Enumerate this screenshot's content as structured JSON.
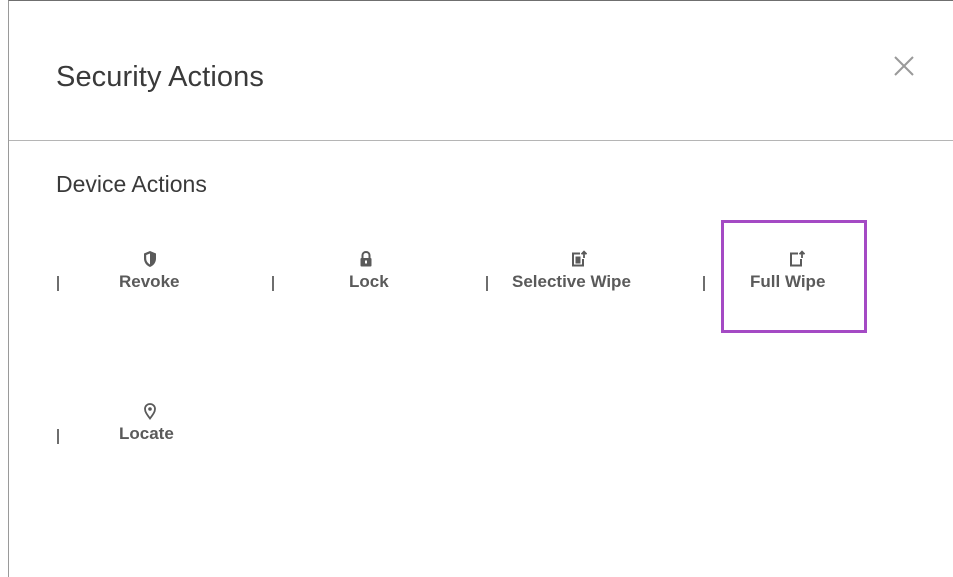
{
  "dialog": {
    "title": "Security Actions",
    "close_icon": "close-icon"
  },
  "device_actions": {
    "heading": "Device Actions",
    "items": [
      {
        "label": "Revoke",
        "icon": "shield-icon"
      },
      {
        "label": "Lock",
        "icon": "lock-icon"
      },
      {
        "label": "Selective Wipe",
        "icon": "selective-wipe-icon"
      },
      {
        "label": "Full Wipe",
        "icon": "full-wipe-icon"
      },
      {
        "label": "Locate",
        "icon": "location-pin-icon"
      }
    ]
  },
  "colors": {
    "highlight": "#a44ac4",
    "text": "#3a3a3a",
    "label": "#5a5a5a"
  }
}
